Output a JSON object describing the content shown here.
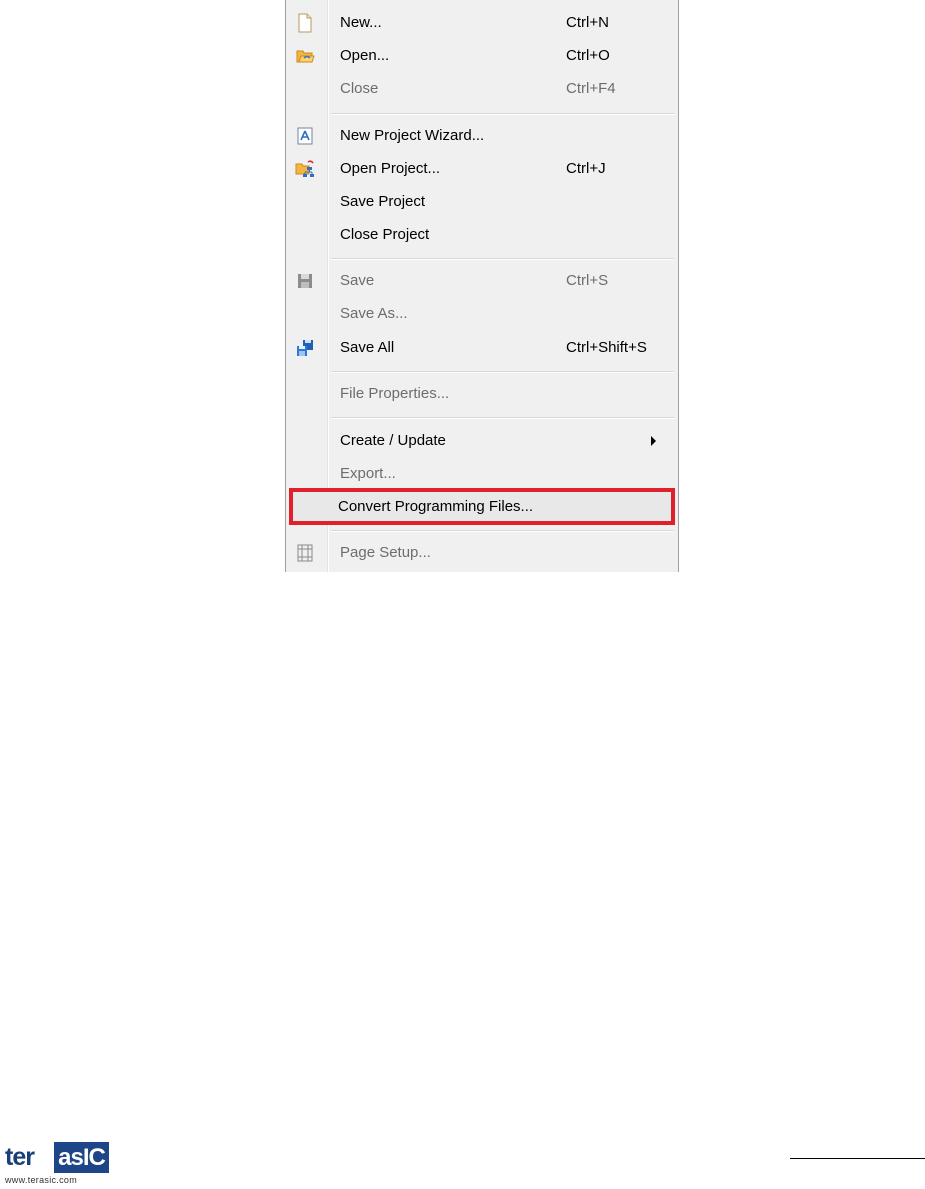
{
  "menu": {
    "items": [
      {
        "label": "New...",
        "shortcut": "Ctrl+N",
        "icon": "new-file-icon",
        "enabled": true
      },
      {
        "label": "Open...",
        "shortcut": "Ctrl+O",
        "icon": "open-folder-icon",
        "enabled": true
      },
      {
        "label": "Close",
        "shortcut": "Ctrl+F4",
        "icon": "",
        "enabled": false
      },
      {
        "label": "New Project Wizard...",
        "shortcut": "",
        "icon": "project-wizard-icon",
        "enabled": true
      },
      {
        "label": "Open Project...",
        "shortcut": "Ctrl+J",
        "icon": "open-project-icon",
        "enabled": true
      },
      {
        "label": "Save Project",
        "shortcut": "",
        "icon": "",
        "enabled": true
      },
      {
        "label": "Close Project",
        "shortcut": "",
        "icon": "",
        "enabled": true
      },
      {
        "label": "Save",
        "shortcut": "Ctrl+S",
        "icon": "save-icon",
        "enabled": false
      },
      {
        "label": "Save As...",
        "shortcut": "",
        "icon": "",
        "enabled": false
      },
      {
        "label": "Save All",
        "shortcut": "Ctrl+Shift+S",
        "icon": "save-all-icon",
        "enabled": true
      },
      {
        "label": "File Properties...",
        "shortcut": "",
        "icon": "",
        "enabled": false
      },
      {
        "label": "Create / Update",
        "shortcut": "",
        "icon": "",
        "enabled": true,
        "submenu": true
      },
      {
        "label": "Export...",
        "shortcut": "",
        "icon": "",
        "enabled": false
      },
      {
        "label": "Convert Programming Files...",
        "shortcut": "",
        "icon": "",
        "enabled": true,
        "highlighted": true
      },
      {
        "label": "Page Setup...",
        "shortcut": "",
        "icon": "page-setup-icon",
        "enabled": false
      }
    ]
  },
  "highlight_color": "#e0202a",
  "logo": {
    "text_left": "ter",
    "text_right": "asIC",
    "url": "www.terasic.com",
    "brand_color": "#1d4587"
  }
}
